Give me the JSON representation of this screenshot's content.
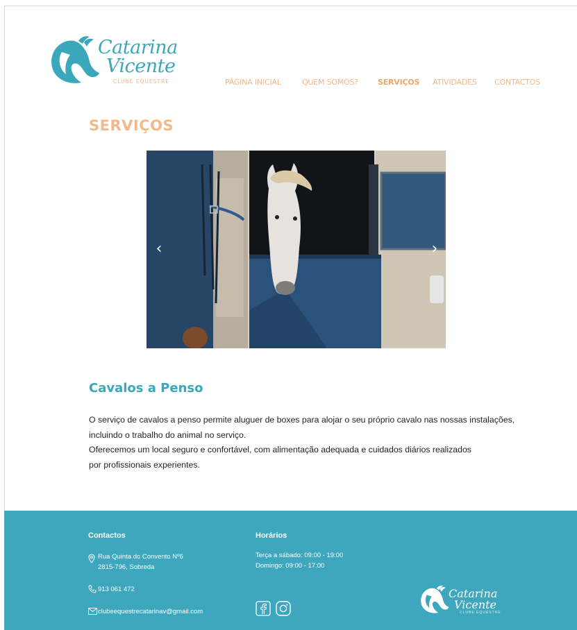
{
  "brand": {
    "name_line1": "Catarina",
    "name_line2": "Vicente",
    "subtitle": "CLUBE EQUESTRE",
    "accent_color": "#3aa7bb",
    "secondary_color": "#f1b886"
  },
  "nav": {
    "items": [
      {
        "label": "PÁGINA INICIAL"
      },
      {
        "label": "QUEM SOMOS?"
      },
      {
        "label": "SERVIÇOS"
      },
      {
        "label": "ATIVIDADES"
      },
      {
        "label": "CONTACTOS"
      }
    ],
    "active": "SERVIÇOS"
  },
  "page": {
    "title": "SERVIÇOS"
  },
  "carousel": {
    "prev_icon": "chevron-left-icon",
    "next_icon": "chevron-right-icon",
    "prev_glyph": "‹",
    "next_glyph": "›"
  },
  "service": {
    "title": "Cavalos a Penso",
    "paragraphs": [
      "O serviço de cavalos a penso permite aluguer de boxes para alojar o seu próprio cavalo nas nossas instalações,",
      "incluindo o trabalho do animal no serviço.",
      "Oferecemos um local seguro e confortável, com alimentação adequada e cuidados diários realizados",
      "por profissionais experientes."
    ]
  },
  "footer": {
    "background_color": "#3ea7bd",
    "contacts_heading": "Contactos",
    "address_line1": "Rua Quinta do Convento Nº6",
    "address_line2": "2815-796, Sobreda",
    "phone": "913 061 472",
    "email": "clubeequestrecatarinav@gmail.com",
    "hours_heading": "Horários",
    "hours_line1": "Terça a sábado: 09:00 - 19:00",
    "hours_line2": "Domingo: 09:00 - 17:00",
    "social": [
      "facebook-icon",
      "instagram-icon"
    ],
    "logo_line1": "Catarina",
    "logo_line2": "Vicente",
    "logo_sub": "CLUBE EQUESTRE"
  }
}
